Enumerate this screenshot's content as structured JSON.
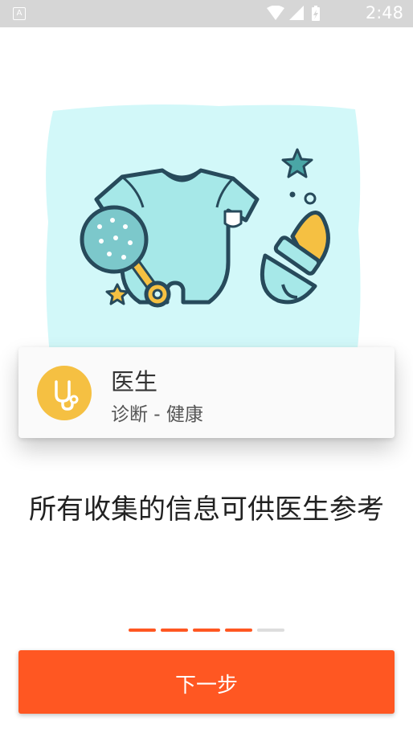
{
  "status_bar": {
    "time": "2:48",
    "left_icon": "A",
    "icons": [
      "wifi-icon",
      "signal-icon",
      "battery-charging-icon"
    ]
  },
  "illustration": {
    "icons": [
      "baby-onesie-icon",
      "rattle-icon",
      "pacifier-icon",
      "star-icon"
    ],
    "colors": {
      "background": "#d2f8f9",
      "teal": "#9fe6e6",
      "yellow": "#f5c042",
      "outline": "#274a5b"
    }
  },
  "card": {
    "title": "医生",
    "subtitle": "诊断 - 健康",
    "icon": "stethoscope-icon",
    "icon_bg": "#f5c042"
  },
  "description": "所有收集的信息可供医生参考",
  "pager": {
    "total": 5,
    "active_count": 4
  },
  "next_button": {
    "label": "下一步",
    "color": "#ff5722"
  }
}
